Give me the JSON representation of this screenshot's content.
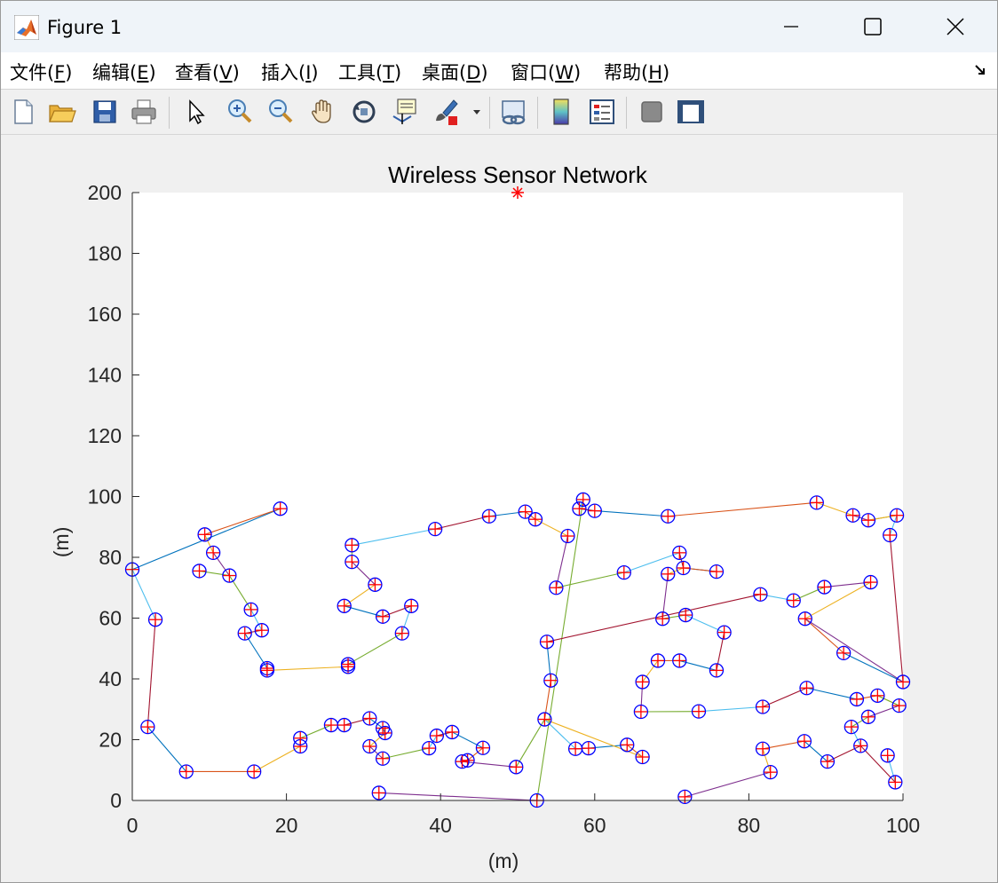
{
  "window": {
    "title": "Figure 1",
    "controls": {
      "minimize": "minimize",
      "maximize": "maximize",
      "close": "close"
    }
  },
  "menu": {
    "items": [
      {
        "pre": "文件(",
        "key": "F",
        "post": ")"
      },
      {
        "pre": "编辑(",
        "key": "E",
        "post": ")"
      },
      {
        "pre": "查看(",
        "key": "V",
        "post": ")"
      },
      {
        "pre": "插入(",
        "key": "I",
        "post": ")"
      },
      {
        "pre": "工具(",
        "key": "T",
        "post": ")"
      },
      {
        "pre": "桌面(",
        "key": "D",
        "post": ")"
      },
      {
        "pre": "窗口(",
        "key": "W",
        "post": ")"
      },
      {
        "pre": "帮助(",
        "key": "H",
        "post": ")"
      }
    ]
  },
  "toolbar": {
    "buttons": [
      "new-figure-icon",
      "open-file-icon",
      "save-icon",
      "print-icon",
      "pointer-icon",
      "zoom-in-icon",
      "zoom-out-icon",
      "pan-hand-icon",
      "rotate-3d-icon",
      "data-cursor-icon",
      "brush-icon",
      "brush-dropdown-icon",
      "link-plot-icon",
      "colorbar-icon",
      "legend-icon",
      "hide-plot-tools-icon",
      "show-plot-tools-icon"
    ]
  },
  "chart_data": {
    "type": "scatter",
    "title": "Wireless Sensor Network",
    "xlabel": "(m)",
    "ylabel": "(m)",
    "xlim": [
      0,
      100
    ],
    "ylim": [
      0,
      200
    ],
    "xticks": [
      0,
      20,
      40,
      60,
      80,
      100
    ],
    "yticks": [
      0,
      20,
      40,
      60,
      80,
      100,
      120,
      140,
      160,
      180,
      200
    ],
    "grid": false,
    "marker_color": "#0000ff",
    "cross_color": "#ff0000",
    "sink": {
      "x": 50,
      "y": 200,
      "marker": "*",
      "color": "#ff0000"
    },
    "line_colors": [
      "#0072bd",
      "#d95319",
      "#edb120",
      "#7e2f8e",
      "#77ac30",
      "#4dbeee",
      "#a2142f"
    ],
    "chains": [
      [
        [
          0,
          76
        ],
        [
          19.2,
          96
        ],
        [
          9.4,
          87.5
        ],
        [
          10.5,
          81.5
        ],
        [
          12.6,
          74
        ],
        [
          15.4,
          62.8
        ],
        [
          16.8,
          56
        ],
        [
          14.6,
          55
        ],
        [
          17.5,
          43.5
        ],
        [
          17.5,
          42.8
        ],
        [
          28,
          44
        ],
        [
          28,
          44.8
        ],
        [
          35,
          55
        ],
        [
          36.2,
          64
        ],
        [
          32.5,
          60.5
        ],
        [
          27.5,
          64
        ],
        [
          27.5,
          64
        ],
        [
          31.5,
          71
        ],
        [
          28.5,
          78.5
        ],
        [
          28.5,
          84
        ],
        [
          39.3,
          89.3
        ],
        [
          46.3,
          93.5
        ],
        [
          51,
          95
        ],
        [
          52.3,
          92.5
        ],
        [
          56.5,
          87
        ],
        [
          55,
          70
        ],
        [
          63.8,
          75
        ],
        [
          71,
          81.5
        ],
        [
          71.5,
          76.5
        ],
        [
          75.8,
          75.3
        ],
        [
          71.5,
          76.5
        ],
        [
          69.5,
          74.5
        ],
        [
          68.8,
          59.8
        ],
        [
          71.8,
          61
        ],
        [
          76.8,
          55.3
        ],
        [
          75.8,
          42.8
        ],
        [
          71,
          46
        ],
        [
          68.2,
          46
        ],
        [
          66.2,
          39
        ],
        [
          66,
          29.2
        ],
        [
          73.5,
          29.3
        ],
        [
          81.8,
          30.8
        ],
        [
          87.5,
          37
        ],
        [
          94,
          33.3
        ],
        [
          96.7,
          34.5
        ],
        [
          99.5,
          31.2
        ],
        [
          95.5,
          27.5
        ],
        [
          93.3,
          24.2
        ],
        [
          94.5,
          18
        ],
        [
          90.2,
          12.8
        ],
        [
          87.2,
          19.5
        ],
        [
          81.8,
          17
        ],
        [
          82.8,
          9.3
        ],
        [
          71.7,
          1.2
        ]
      ],
      [
        [
          8.7,
          75.5
        ],
        [
          12.6,
          74
        ]
      ],
      [
        [
          3,
          59.5
        ],
        [
          0,
          76
        ]
      ],
      [
        [
          3,
          59.5
        ],
        [
          2,
          24.2
        ],
        [
          7,
          9.5
        ],
        [
          15.8,
          9.5
        ],
        [
          21.8,
          17.8
        ],
        [
          21.8,
          20.5
        ],
        [
          25.8,
          24.8
        ],
        [
          27.5,
          24.8
        ],
        [
          30.8,
          27
        ],
        [
          32.5,
          23.8
        ],
        [
          32.8,
          22.2
        ],
        [
          30.8,
          17.8
        ],
        [
          32.5,
          13.8
        ],
        [
          38.5,
          17.2
        ],
        [
          39.5,
          21.3
        ],
        [
          41.5,
          22.5
        ],
        [
          45.5,
          17.3
        ],
        [
          43.5,
          13.2
        ],
        [
          42.8,
          12.8
        ],
        [
          49.8,
          11
        ],
        [
          53.5,
          26.7
        ],
        [
          57.5,
          17
        ],
        [
          59.2,
          17.2
        ],
        [
          64.2,
          18.3
        ],
        [
          66.2,
          14.3
        ],
        [
          53.5,
          26.7
        ]
      ],
      [
        [
          32,
          2.5
        ],
        [
          52.5,
          0
        ],
        [
          58.5,
          99
        ],
        [
          58,
          96
        ],
        [
          60,
          95.3
        ],
        [
          69.5,
          93.5
        ],
        [
          88.8,
          98
        ],
        [
          93.5,
          93.8
        ],
        [
          95.5,
          92.2
        ],
        [
          99.2,
          93.8
        ],
        [
          98.3,
          87.3
        ],
        [
          100,
          39
        ],
        [
          92.3,
          48.5
        ],
        [
          87.3,
          59.8
        ],
        [
          95.8,
          71.8
        ],
        [
          89.8,
          70.2
        ],
        [
          85.8,
          65.8
        ],
        [
          81.5,
          67.8
        ],
        [
          53.8,
          52.2
        ],
        [
          54.3,
          39.5
        ],
        [
          53.5,
          26.7
        ]
      ],
      [
        [
          95.5,
          92.2
        ],
        [
          99.2,
          93.8
        ]
      ],
      [
        [
          100,
          39
        ],
        [
          87.3,
          59.8
        ]
      ],
      [
        [
          96.7,
          34.5
        ],
        [
          99.5,
          31.2
        ]
      ],
      [
        [
          98,
          14.8
        ],
        [
          99,
          6
        ],
        [
          94.5,
          18
        ]
      ],
      [
        [
          32.5,
          23.8
        ],
        [
          32.8,
          22.2
        ]
      ]
    ]
  }
}
